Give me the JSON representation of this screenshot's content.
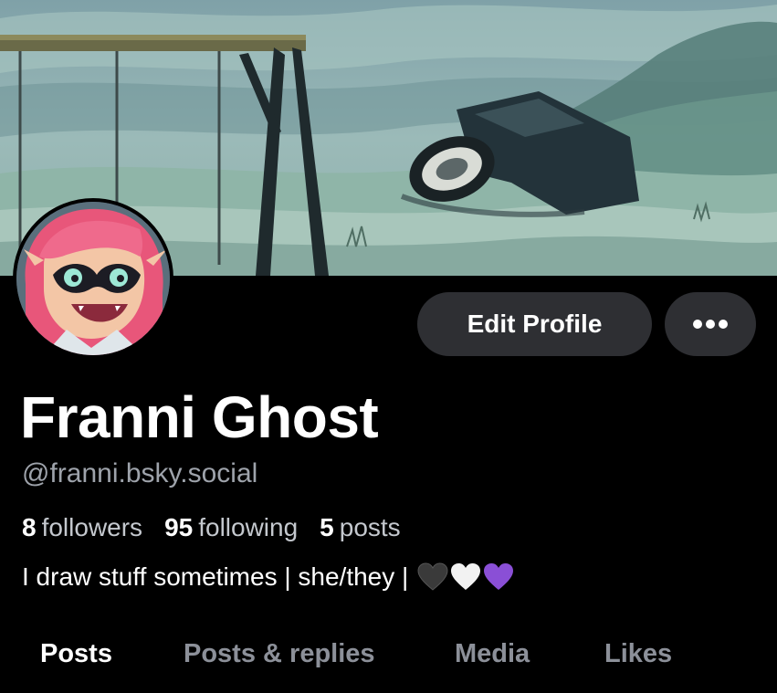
{
  "profile": {
    "display_name": "Franni Ghost",
    "handle": "@franni.bsky.social",
    "bio": "I draw stuff sometimes | she/they |",
    "bio_hearts": [
      "black-heart",
      "white-heart",
      "purple-heart"
    ]
  },
  "actions": {
    "edit_label": "Edit Profile",
    "more_icon": "ellipsis-icon"
  },
  "stats": {
    "followers_count": "8",
    "followers_label": "followers",
    "following_count": "95",
    "following_label": "following",
    "posts_count": "5",
    "posts_label": "posts"
  },
  "tabs": [
    {
      "label": "Posts",
      "active": true
    },
    {
      "label": "Posts & replies",
      "active": false
    },
    {
      "label": "Media",
      "active": false
    },
    {
      "label": "Likes",
      "active": false
    }
  ],
  "colors": {
    "background": "#000000",
    "button_bg": "#2e2f33",
    "handle_text": "#9ea3ab",
    "inactive_tab": "#8c9099",
    "heart_black": "#3a3a3a",
    "heart_white": "#f2f2f2",
    "heart_purple": "#8a4fd6"
  }
}
